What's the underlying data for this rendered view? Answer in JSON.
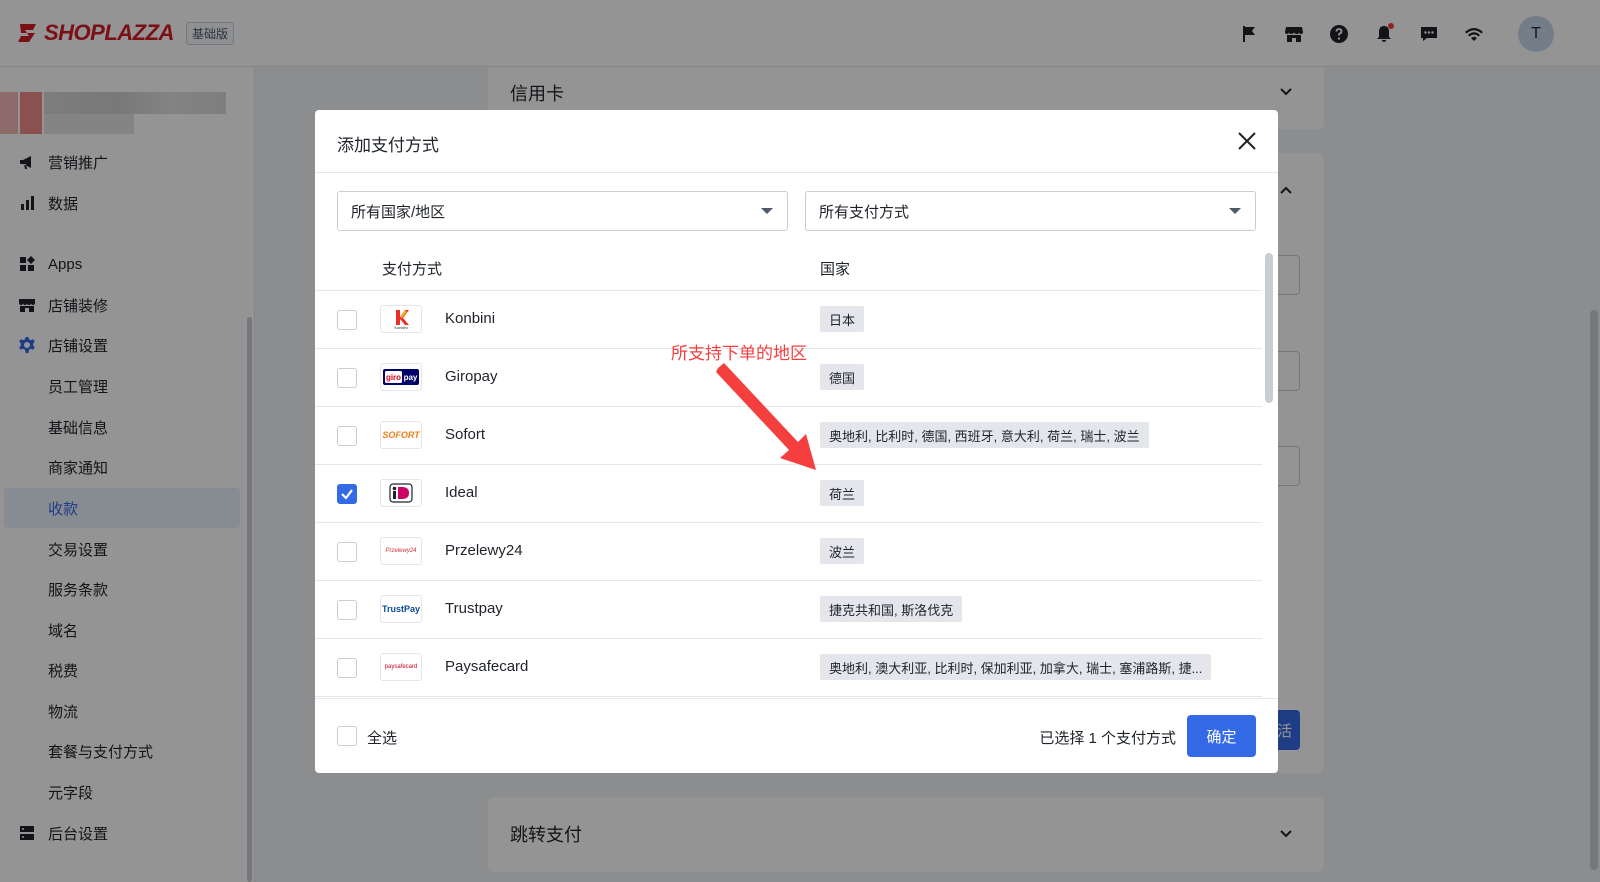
{
  "brand": {
    "logo_text": "SHOPLAZZA",
    "plan_badge": "基础版"
  },
  "header": {
    "icons": [
      "flag-icon",
      "store-icon",
      "help-icon",
      "bell-icon",
      "chat-icon",
      "wifi-icon"
    ],
    "avatar_initial": "T"
  },
  "sidebar": {
    "items": [
      {
        "label": "营销推广",
        "icon": "megaphone-icon"
      },
      {
        "label": "数据",
        "icon": "bar-chart-icon"
      },
      {
        "label": "Apps",
        "icon": "apps-icon"
      },
      {
        "label": "店铺装修",
        "icon": "store-icon"
      },
      {
        "label": "店铺设置",
        "icon": "gear-icon"
      }
    ],
    "sub_items": [
      "员工管理",
      "基础信息",
      "商家通知",
      "收款",
      "交易设置",
      "服务条款",
      "域名",
      "税费",
      "物流",
      "套餐与支付方式",
      "元字段"
    ],
    "active_sub": "收款",
    "footer_item": {
      "label": "后台设置",
      "icon": "server-icon"
    }
  },
  "background": {
    "card1_title": "信用卡",
    "card2_button": "激活",
    "card3_title": "跳转支付"
  },
  "modal": {
    "title": "添加支付方式",
    "country_filter": "所有国家/地区",
    "method_filter": "所有支付方式",
    "columns": {
      "method": "支付方式",
      "country": "国家"
    },
    "rows": [
      {
        "name": "Konbini",
        "countries": "日本",
        "checked": false
      },
      {
        "name": "Giropay",
        "countries": "德国",
        "checked": false
      },
      {
        "name": "Sofort",
        "countries": "奥地利, 比利时, 德国, 西班牙, 意大利, 荷兰, 瑞士, 波兰",
        "checked": false
      },
      {
        "name": "Ideal",
        "countries": "荷兰",
        "checked": true
      },
      {
        "name": "Przelewy24",
        "countries": "波兰",
        "checked": false
      },
      {
        "name": "Trustpay",
        "countries": "捷克共和国, 斯洛伐克",
        "checked": false
      },
      {
        "name": "Paysafecard",
        "countries": "奥地利, 澳大利亚, 比利时, 保加利亚, 加拿大, 瑞士, 塞浦路斯, 捷...",
        "checked": false
      }
    ],
    "logos": {
      "giropay": "giro pay",
      "sofort": "SOFORT",
      "ideal": "iD",
      "trustpay": "TrustPay",
      "przelewy": "Przelewy24",
      "paysafecard": "paysafecard",
      "konbini": "Konbini"
    },
    "select_all": "全选",
    "selected_count": "已选择 1 个支付方式",
    "confirm": "确定"
  },
  "annotation": {
    "text": "所支持下单的地区"
  },
  "colors": {
    "primary": "#356ae6",
    "brand_red": "#d21d27",
    "annotation": "#f53f3f"
  }
}
